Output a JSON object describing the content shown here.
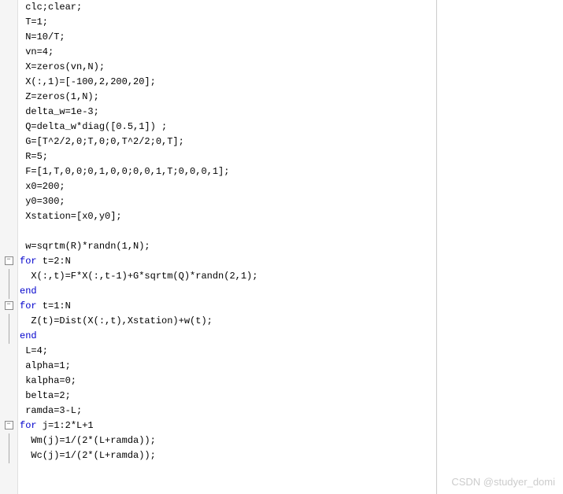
{
  "code": {
    "lines": [
      {
        "indent": 1,
        "t": "clc;clear;",
        "fold": ""
      },
      {
        "indent": 1,
        "t": "T=1;",
        "fold": ""
      },
      {
        "indent": 1,
        "t": "N=10/T;",
        "fold": ""
      },
      {
        "indent": 1,
        "t": "vn=4;",
        "fold": ""
      },
      {
        "indent": 1,
        "t": "X=zeros(vn,N);",
        "fold": ""
      },
      {
        "indent": 1,
        "t": "X(:,1)=[-100,2,200,20];",
        "fold": ""
      },
      {
        "indent": 1,
        "t": "Z=zeros(1,N);",
        "fold": ""
      },
      {
        "indent": 1,
        "t": "delta_w=1e-3;",
        "fold": ""
      },
      {
        "indent": 1,
        "t": "Q=delta_w*diag([0.5,1]) ;",
        "fold": ""
      },
      {
        "indent": 1,
        "t": "G=[T^2/2,0;T,0;0,T^2/2;0,T];",
        "fold": ""
      },
      {
        "indent": 1,
        "t": "R=5;",
        "fold": ""
      },
      {
        "indent": 1,
        "t": "F=[1,T,0,0;0,1,0,0;0,0,1,T;0,0,0,1];",
        "fold": ""
      },
      {
        "indent": 1,
        "t": "x0=200;",
        "fold": ""
      },
      {
        "indent": 1,
        "t": "y0=300;",
        "fold": ""
      },
      {
        "indent": 1,
        "t": "Xstation=[x0,y0];",
        "fold": ""
      },
      {
        "indent": 1,
        "t": "",
        "fold": ""
      },
      {
        "indent": 1,
        "t": "w=sqrtm(R)*randn(1,N);",
        "fold": ""
      },
      {
        "indent": 0,
        "kw": "for",
        "rest": " t=2:N",
        "fold": "minus"
      },
      {
        "indent": 2,
        "t": "X(:,t)=F*X(:,t-1)+G*sqrtm(Q)*randn(2,1);",
        "fold": "line"
      },
      {
        "indent": 0,
        "kw": "end",
        "rest": "",
        "fold": "end"
      },
      {
        "indent": 0,
        "kw": "for",
        "rest": " t=1:N",
        "fold": "minus"
      },
      {
        "indent": 2,
        "t": "Z(t)=Dist(X(:,t),Xstation)+w(t);",
        "fold": "line"
      },
      {
        "indent": 0,
        "kw": "end",
        "rest": "",
        "fold": "end"
      },
      {
        "indent": 1,
        "t": "L=4;",
        "fold": ""
      },
      {
        "indent": 1,
        "t": "alpha=1;",
        "fold": ""
      },
      {
        "indent": 1,
        "t": "kalpha=0;",
        "fold": ""
      },
      {
        "indent": 1,
        "t": "belta=2;",
        "fold": ""
      },
      {
        "indent": 1,
        "t": "ramda=3-L;",
        "fold": ""
      },
      {
        "indent": 0,
        "kw": "for",
        "rest": " j=1:2*L+1",
        "fold": "minus"
      },
      {
        "indent": 2,
        "t": "Wm(j)=1/(2*(L+ramda));",
        "fold": "line"
      },
      {
        "indent": 2,
        "t": "Wc(j)=1/(2*(L+ramda));",
        "fold": "line"
      }
    ]
  },
  "watermark": "CSDN @studyer_domi"
}
